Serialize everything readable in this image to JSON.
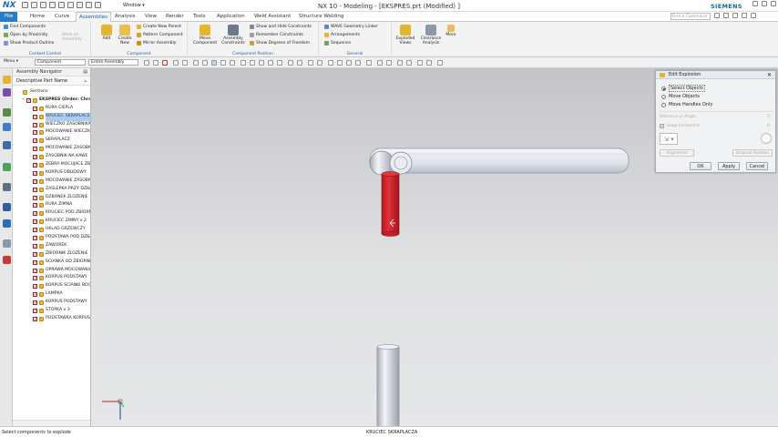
{
  "window": {
    "title": "NX 10 - Modeling - [EKSPRES.prt (Modified) ]",
    "brand": "SIEMENS",
    "logo": "NX",
    "window_menu": "Window"
  },
  "tabs": {
    "file": "File",
    "items": [
      "Home",
      "Curve",
      "Assemblies",
      "Analysis",
      "View",
      "Render",
      "Tools",
      "Application",
      "Weld Assistant",
      "Structure Welding"
    ],
    "active": "Assemblies"
  },
  "search": {
    "placeholder": "Find a Command"
  },
  "ribbon": {
    "context_control": {
      "label": "Context Control",
      "items": [
        "Find Components",
        "Open by Proximity",
        "Show Product Outline"
      ],
      "work_on": "Work on Assembly"
    },
    "component": {
      "label": "Component",
      "add": "Add",
      "create_new": "Create New",
      "items": [
        "Create New Parent",
        "Pattern Component",
        "Mirror Assembly"
      ]
    },
    "component_position": {
      "label": "Component Position",
      "move": "Move Component",
      "constraints": "Assembly Constraints",
      "items": [
        "Show and Hide Constraints",
        "Remember Constraints",
        "Show Degrees of Freedom"
      ]
    },
    "general": {
      "label": "General",
      "items": [
        "WAVE Geometry Linker",
        "Arrangements",
        "Sequence"
      ]
    },
    "exploded_views": "Exploded Views",
    "clearance": "Clearance Analysis",
    "more": "More"
  },
  "toolbar": {
    "menu": "Menu",
    "filter": "Component",
    "scope": "Entire Assembly"
  },
  "navigator": {
    "title": "Assembly Navigator",
    "column": "Descriptive Part Name",
    "sections": "Sections",
    "root": "EKSPRES (Order: Chrono",
    "items": [
      "RURA CIEPLA",
      "KRUCIEC SKRAPLACZA",
      "WIECZKO ZASOBNIKA",
      "MOCOWANIE WIECZKA",
      "SKRAPLACZ",
      "MOCOWANIE ZASOBNIKA",
      "ZASOBNIK NA KAWE",
      "ZEBRA MOCUJACE ZB",
      "KORPUS OBUDOWY",
      "MOCOWANIE ZASOBNIKA",
      "ZASLEPKA PRZY DZBANK",
      "DZBANEK ZLOZENIE",
      "RURA ZIMNA",
      "KRUCIEC POD ZBIORNIK",
      "KRUCIEC ZIMNY x 2",
      "UKLAD GRZEWCZY",
      "PODSTAWA POD DZBANEK",
      "ZAWOREK",
      "ZBIORNIK ZLOZENIE",
      "SCIANKA OD ZBIORNIKA",
      "OPRAWA MOCOWANIA",
      "KORPUS PODSTAWY",
      "KORPUS SCIANKI BOCZNEJ",
      "LAMPKA",
      "KORPUS PODSTAWY",
      "STOPKA x 3",
      "PODSTAWKA KORPUSU"
    ],
    "selected": 1
  },
  "dialog": {
    "title": "Edit Explosion",
    "options": [
      "Select Objects",
      "Move Objects",
      "Move Handles Only"
    ],
    "selected_option": 0,
    "distance_label": "Distance or Angle",
    "distance_value": "0",
    "snap_label": "Snap Increment",
    "snap_value": "0",
    "alignment": "Alignment",
    "original_position": "Original Position",
    "ok": "OK",
    "apply": "Apply",
    "cancel": "Cancel"
  },
  "status": {
    "left": "Select components to explode",
    "center": "KRUCIEC SKRAPLACZA"
  },
  "colors": {
    "accent": "#2a7dc4",
    "selected_part": "#d42a33",
    "tab_active_text": "#1a5fa8"
  }
}
